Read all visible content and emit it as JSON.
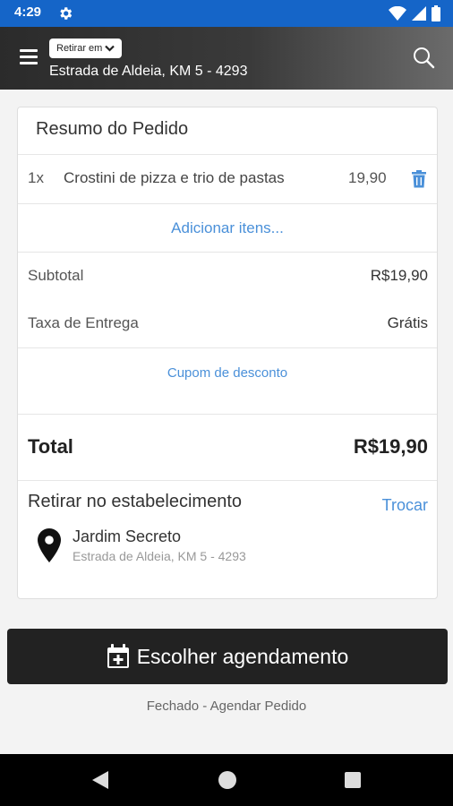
{
  "status_bar": {
    "time": "4:29",
    "icons": [
      "gear-icon",
      "wifi-icon",
      "signal-icon",
      "battery-icon"
    ]
  },
  "header": {
    "mode_label": "Retirar em",
    "address": "Estrada de Aldeia, KM 5 - 4293",
    "icons": [
      "menu-icon",
      "chevron-down-icon",
      "search-icon"
    ]
  },
  "order": {
    "title": "Resumo do Pedido",
    "items": [
      {
        "qty": "1x",
        "name": "Crostini de pizza e trio de pastas",
        "price": "19,90"
      }
    ],
    "add_items_label": "Adicionar itens...",
    "subtotal_label": "Subtotal",
    "subtotal_value": "R$19,90",
    "delivery_label": "Taxa de Entrega",
    "delivery_value": "Grátis",
    "coupon_label": "Cupom de desconto",
    "total_label": "Total",
    "total_value": "R$19,90"
  },
  "pickup": {
    "title": "Retirar no estabelecimento",
    "swap_label": "Trocar",
    "store_name": "Jardim Secreto",
    "store_address": "Estrada de Aldeia, KM 5 - 4293"
  },
  "schedule_button_label": "Escolher agendamento",
  "closed_note": "Fechado - Agendar Pedido",
  "colors": {
    "status_bar": "#1565c8",
    "accent_link": "#4a90d9",
    "primary_button": "#222222"
  }
}
